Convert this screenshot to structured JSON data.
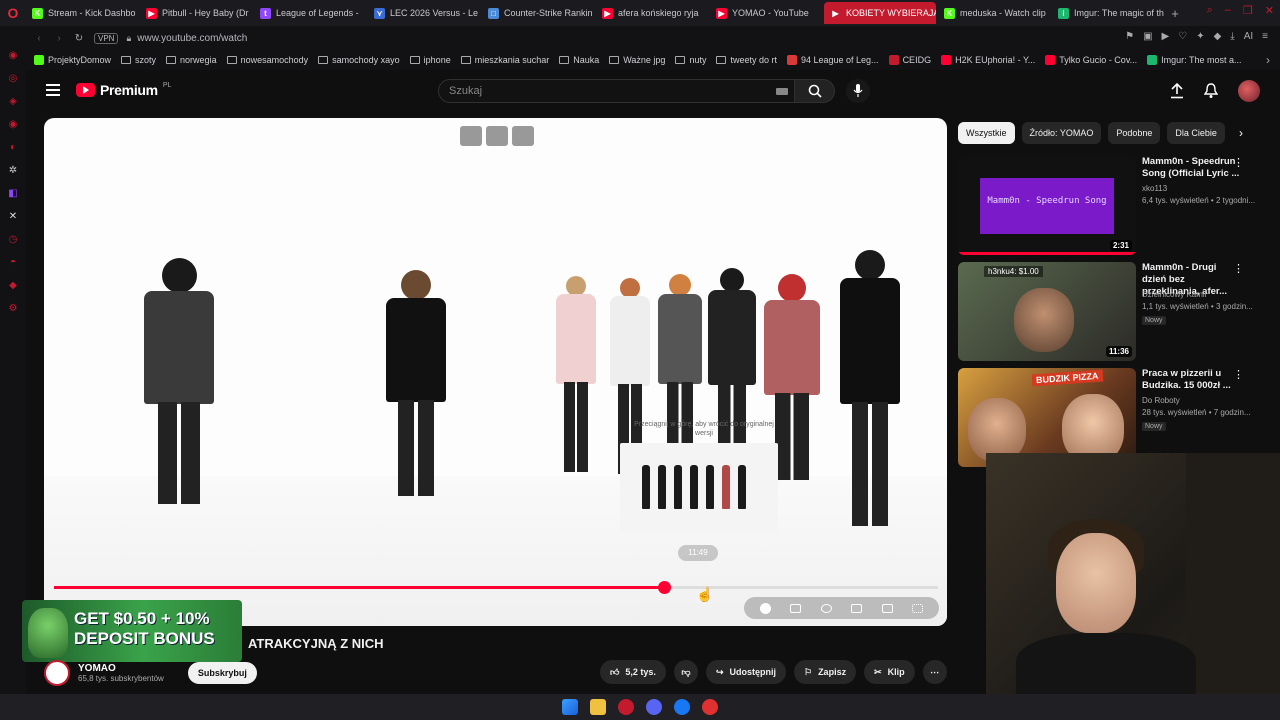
{
  "browser": {
    "tabs": [
      {
        "label": "Stream - Kick Dashbo",
        "color": "#53fc18",
        "glyph": "K",
        "active": false
      },
      {
        "label": "Pitbull - Hey Baby (Dr",
        "color": "#ff0033",
        "glyph": "▶",
        "active": false
      },
      {
        "label": "League of Legends -",
        "color": "#9146ff",
        "glyph": "t",
        "active": false
      },
      {
        "label": "LEC 2026 Versus - Le",
        "color": "#3a6cd6",
        "glyph": "⋎",
        "active": false
      },
      {
        "label": "Counter-Strike Rankin",
        "color": "#4a8ad8",
        "glyph": "□",
        "active": false
      },
      {
        "label": "afera końskiego ryja",
        "color": "#ff0033",
        "glyph": "▶",
        "active": false
      },
      {
        "label": "YOMAO - YouTube",
        "color": "#ff0033",
        "glyph": "▶",
        "active": false
      },
      {
        "label": "KOBIETY WYBIERAJĄ",
        "color": "#ffffff",
        "glyph": "▶",
        "active": true
      },
      {
        "label": "meduska - Watch clip",
        "color": "#53fc18",
        "glyph": "K",
        "active": false
      },
      {
        "label": "Imgur: The magic of th",
        "color": "#1bb76e",
        "glyph": "i",
        "active": false
      }
    ],
    "url": "www.youtube.com/watch",
    "vpn_label": "VPN",
    "ai_label": "AI",
    "bookmarks": [
      {
        "label": "ProjektyDomow",
        "type": "fav",
        "color": "#53fc18"
      },
      {
        "label": "szoty",
        "type": "folder"
      },
      {
        "label": "norwegia",
        "type": "folder"
      },
      {
        "label": "nowesamochody",
        "type": "folder"
      },
      {
        "label": "samochody xayo",
        "type": "folder"
      },
      {
        "label": "iphone",
        "type": "folder"
      },
      {
        "label": "mieszkania suchar",
        "type": "folder"
      },
      {
        "label": "Nauka",
        "type": "folder"
      },
      {
        "label": "Ważne jpg",
        "type": "folder"
      },
      {
        "label": "nuty",
        "type": "folder"
      },
      {
        "label": "tweety do rt",
        "type": "folder"
      },
      {
        "label": "94 League of Leg...",
        "type": "fav",
        "color": "#d83a3a"
      },
      {
        "label": "CEIDG",
        "type": "fav",
        "color": "#c41a2e"
      },
      {
        "label": "H2K EUphoria! - Y...",
        "type": "fav",
        "color": "#ff0033"
      },
      {
        "label": "Tylko Gucio - Cov...",
        "type": "fav",
        "color": "#ff0033"
      },
      {
        "label": "Imgur: The most a...",
        "type": "fav",
        "color": "#1bb76e"
      }
    ]
  },
  "youtube": {
    "logo_text": "Premium",
    "logo_region": "PL",
    "search_placeholder": "Szukaj",
    "player": {
      "hover_time": "11:49",
      "subtitle_hint": "Przeciągnij w górę, aby wrócić do oryginalnej wersji",
      "progress_fraction": 0.69
    },
    "ad": {
      "line1": "GET $0.50 + 10%",
      "line2": "DEPOSIT BONUS"
    },
    "video_title": "ATRAKCYJNĄ Z NICH",
    "channel": {
      "name": "YOMAO",
      "subscribers": "65,8 tys. subskrybentów",
      "subscribe_label": "Subskrybuj"
    },
    "actions": {
      "likes": "5,2 tys.",
      "share": "Udostępnij",
      "save": "Zapisz",
      "clip": "Klip"
    },
    "chips": [
      "Wszystkie",
      "Źródło: YOMAO",
      "Podobne",
      "Dla Ciebie"
    ],
    "recommendations": [
      {
        "title": "Mamm0n - Speedrun Song (Official Lyric ...",
        "channel": "xko113",
        "views": "6,4 tys. wyświetleń • 2 tygodni...",
        "duration": "2:31",
        "thumb_text": "Mamm0n - Speedrun Song",
        "badge": "",
        "watched": 1.0
      },
      {
        "title": "Mamm0n - Drugi dzień bez przeklinania, afer...",
        "channel": "Dzielnicowy Kamil",
        "views": "1,1 tys. wyświetleń • 3 godzin...",
        "duration": "11:36",
        "thumb_text": "h3nku4: $1.00",
        "badge": "Nowy",
        "watched": 0.0
      },
      {
        "title": "Praca w pizzerii u Budzika. 15 000zł ...",
        "channel": "Do Roboty",
        "views": "28 tys. wyświetleń • 7 godzin...",
        "duration": "",
        "thumb_text": "BUDZIK PIZZA",
        "badge": "Nowy",
        "watched": 0.0
      }
    ]
  }
}
